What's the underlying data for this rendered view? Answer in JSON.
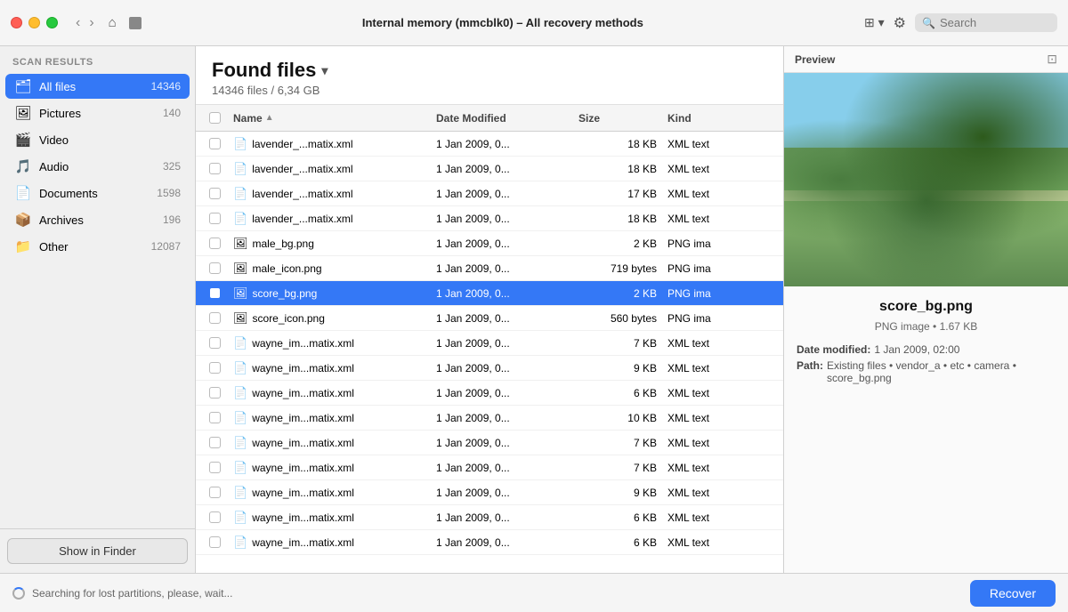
{
  "window": {
    "title": "Internal memory (mmcblk0) – All recovery methods"
  },
  "titlebar": {
    "back_label": "‹",
    "forward_label": "›",
    "home_label": "⌂",
    "search_placeholder": "Search"
  },
  "sidebar": {
    "header": "Scan results",
    "items": [
      {
        "id": "all-files",
        "icon": "🗂",
        "label": "All files",
        "count": "14346",
        "active": true
      },
      {
        "id": "pictures",
        "icon": "🖼",
        "label": "Pictures",
        "count": "140",
        "active": false
      },
      {
        "id": "video",
        "icon": "🎬",
        "label": "Video",
        "count": "",
        "active": false
      },
      {
        "id": "audio",
        "icon": "🎵",
        "label": "Audio",
        "count": "325",
        "active": false
      },
      {
        "id": "documents",
        "icon": "📄",
        "label": "Documents",
        "count": "1598",
        "active": false
      },
      {
        "id": "archives",
        "icon": "📦",
        "label": "Archives",
        "count": "196",
        "active": false
      },
      {
        "id": "other",
        "icon": "📁",
        "label": "Other",
        "count": "12087",
        "active": false
      }
    ],
    "show_finder_label": "Show in Finder"
  },
  "content": {
    "title": "Found files",
    "file_count": "14346 files / 6,34 GB",
    "columns": [
      "Name",
      "Date Modified",
      "Size",
      "Kind"
    ],
    "rows": [
      {
        "id": 1,
        "icon": "📄",
        "name": "lavender_...matix.xml",
        "date": "1 Jan 2009, 0...",
        "size": "18 KB",
        "kind": "XML text",
        "selected": false
      },
      {
        "id": 2,
        "icon": "📄",
        "name": "lavender_...matix.xml",
        "date": "1 Jan 2009, 0...",
        "size": "18 KB",
        "kind": "XML text",
        "selected": false
      },
      {
        "id": 3,
        "icon": "📄",
        "name": "lavender_...matix.xml",
        "date": "1 Jan 2009, 0...",
        "size": "17 KB",
        "kind": "XML text",
        "selected": false
      },
      {
        "id": 4,
        "icon": "📄",
        "name": "lavender_...matix.xml",
        "date": "1 Jan 2009, 0...",
        "size": "18 KB",
        "kind": "XML text",
        "selected": false
      },
      {
        "id": 5,
        "icon": "🖼",
        "name": "male_bg.png",
        "date": "1 Jan 2009, 0...",
        "size": "2 KB",
        "kind": "PNG ima",
        "selected": false
      },
      {
        "id": 6,
        "icon": "🖼",
        "name": "male_icon.png",
        "date": "1 Jan 2009, 0...",
        "size": "719 bytes",
        "kind": "PNG ima",
        "selected": false
      },
      {
        "id": 7,
        "icon": "🖼",
        "name": "score_bg.png",
        "date": "1 Jan 2009, 0...",
        "size": "2 KB",
        "kind": "PNG ima",
        "selected": true
      },
      {
        "id": 8,
        "icon": "🖼",
        "name": "score_icon.png",
        "date": "1 Jan 2009, 0...",
        "size": "560 bytes",
        "kind": "PNG ima",
        "selected": false
      },
      {
        "id": 9,
        "icon": "📄",
        "name": "wayne_im...matix.xml",
        "date": "1 Jan 2009, 0...",
        "size": "7 KB",
        "kind": "XML text",
        "selected": false
      },
      {
        "id": 10,
        "icon": "📄",
        "name": "wayne_im...matix.xml",
        "date": "1 Jan 2009, 0...",
        "size": "9 KB",
        "kind": "XML text",
        "selected": false
      },
      {
        "id": 11,
        "icon": "📄",
        "name": "wayne_im...matix.xml",
        "date": "1 Jan 2009, 0...",
        "size": "6 KB",
        "kind": "XML text",
        "selected": false
      },
      {
        "id": 12,
        "icon": "📄",
        "name": "wayne_im...matix.xml",
        "date": "1 Jan 2009, 0...",
        "size": "10 KB",
        "kind": "XML text",
        "selected": false
      },
      {
        "id": 13,
        "icon": "📄",
        "name": "wayne_im...matix.xml",
        "date": "1 Jan 2009, 0...",
        "size": "7 KB",
        "kind": "XML text",
        "selected": false
      },
      {
        "id": 14,
        "icon": "📄",
        "name": "wayne_im...matix.xml",
        "date": "1 Jan 2009, 0...",
        "size": "7 KB",
        "kind": "XML text",
        "selected": false
      },
      {
        "id": 15,
        "icon": "📄",
        "name": "wayne_im...matix.xml",
        "date": "1 Jan 2009, 0...",
        "size": "9 KB",
        "kind": "XML text",
        "selected": false
      },
      {
        "id": 16,
        "icon": "📄",
        "name": "wayne_im...matix.xml",
        "date": "1 Jan 2009, 0...",
        "size": "6 KB",
        "kind": "XML text",
        "selected": false
      },
      {
        "id": 17,
        "icon": "📄",
        "name": "wayne_im...matix.xml",
        "date": "1 Jan 2009, 0...",
        "size": "6 KB",
        "kind": "XML text",
        "selected": false
      }
    ]
  },
  "preview": {
    "header_label": "Preview",
    "filename": "score_bg.png",
    "meta": "PNG image • 1.67 KB",
    "date_modified_label": "Date modified:",
    "date_modified_value": "1 Jan 2009, 02:00",
    "path_label": "Path:",
    "path_value": "Existing files • vendor_a • etc • camera • score_bg.png"
  },
  "bottom": {
    "searching_label": "Searching for lost partitions, please, wait...",
    "recover_label": "Recover"
  }
}
